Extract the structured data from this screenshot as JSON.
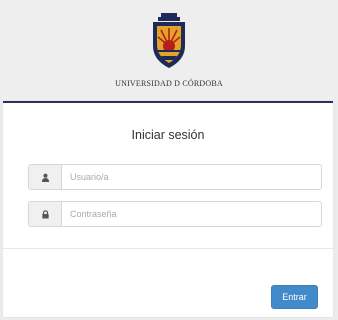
{
  "header": {
    "university_name": "UNIVERSIDAD D CÓRDOBA"
  },
  "login": {
    "title": "Iniciar sesión",
    "username": {
      "placeholder": "Usuario/a",
      "value": "",
      "icon": "user-icon"
    },
    "password": {
      "placeholder": "Contraseña",
      "value": "",
      "icon": "lock-icon"
    },
    "submit_label": "Entrar"
  },
  "colors": {
    "accent": "#283258",
    "button": "#428bca",
    "logo_gold": "#e0a526",
    "logo_red": "#b81d1d",
    "logo_navy": "#1f2a5a"
  }
}
